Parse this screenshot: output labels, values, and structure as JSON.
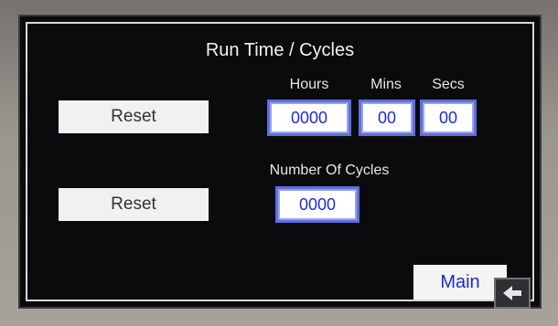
{
  "screen": {
    "title": "Run Time / Cycles"
  },
  "runtime": {
    "hours_label": "Hours",
    "mins_label": "Mins",
    "secs_label": "Secs",
    "hours_value": "0000",
    "mins_value": "00",
    "secs_value": "00",
    "reset_label": "Reset"
  },
  "cycles": {
    "label": "Number Of Cycles",
    "value": "0000",
    "reset_label": "Reset"
  },
  "nav": {
    "main_label": "Main",
    "back_icon": "back-arrow-icon"
  },
  "colors": {
    "screen_bg": "#0b0b0d",
    "field_text": "#1f2bd6",
    "field_border": "#5f6ee0"
  }
}
